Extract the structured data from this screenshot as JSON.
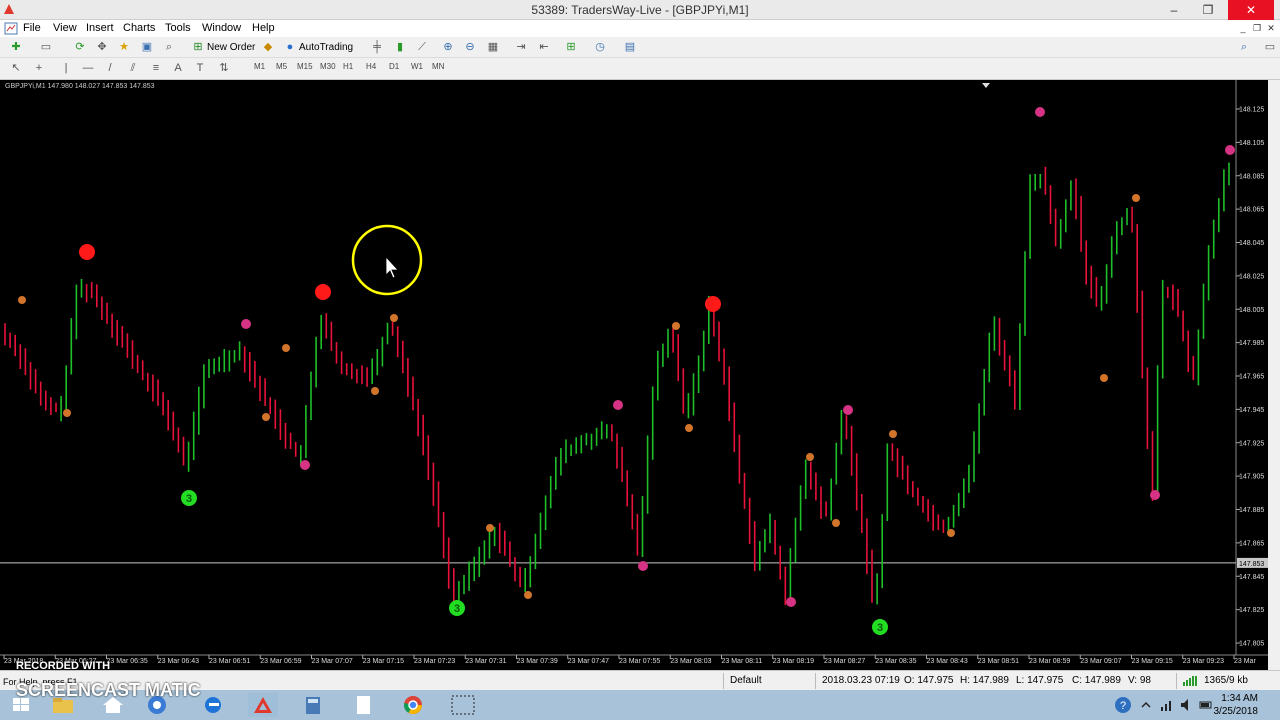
{
  "window": {
    "title": "53389: TradersWay-Live - [GBPJPYi,M1]",
    "controls": {
      "minimize": "–",
      "maximize": "❐",
      "close": "✕"
    }
  },
  "menu": [
    "File",
    "View",
    "Insert",
    "Charts",
    "Tools",
    "Window",
    "Help"
  ],
  "toolbar": {
    "new_order": "New Order",
    "autotrading": "AutoTrading",
    "timeframes": [
      "M1",
      "M5",
      "M15",
      "M30",
      "H1",
      "H4",
      "D1",
      "W1",
      "MN"
    ]
  },
  "chart": {
    "symbol_info": "GBPJPYi,M1  147.980 148.027 147.853 147.853",
    "current_price": "147.853",
    "price_labels": [
      "148.125",
      "148.105",
      "148.085",
      "148.065",
      "148.045",
      "148.025",
      "148.005",
      "147.985",
      "147.965",
      "147.945",
      "147.925",
      "147.905",
      "147.885",
      "147.865",
      "147.845",
      "147.825",
      "147.805"
    ],
    "time_labels": [
      "23 Mar 2018",
      "23 Mar 06:27",
      "23 Mar 06:35",
      "23 Mar 06:43",
      "23 Mar 06:51",
      "23 Mar 06:59",
      "23 Mar 07:07",
      "23 Mar 07:15",
      "23 Mar 07:23",
      "23 Mar 07:31",
      "23 Mar 07:39",
      "23 Mar 07:47",
      "23 Mar 07:55",
      "23 Mar 08:03",
      "23 Mar 08:11",
      "23 Mar 08:19",
      "23 Mar 08:27",
      "23 Mar 08:35",
      "23 Mar 08:43",
      "23 Mar 08:51",
      "23 Mar 08:59",
      "23 Mar 09:07",
      "23 Mar 09:15",
      "23 Mar 09:23",
      "23 Mar"
    ],
    "signal_label": "3",
    "colors": {
      "bull": "#1fbf2a",
      "bear": "#e8123a",
      "bg": "#000000",
      "red_marker": "#ff1a1a",
      "green_marker": "#22dd22",
      "orange_dot": "#d2742a",
      "pink_dot": "#d63384"
    }
  },
  "status": {
    "help": "For Help, press F1",
    "profile": "Default",
    "datetime": "2018.03.23 07:19",
    "open": "O: 147.975",
    "high": "H: 147.989",
    "low": "L: 147.975",
    "close": "C: 147.989",
    "volume": "V: 98",
    "traffic": "1365/9 kb"
  },
  "taskbar": {
    "time": "1:34 AM",
    "date": "3/25/2018"
  },
  "watermark": {
    "line1": "RECORDED WITH",
    "line2": "SCREENCAST  MATIC"
  }
}
